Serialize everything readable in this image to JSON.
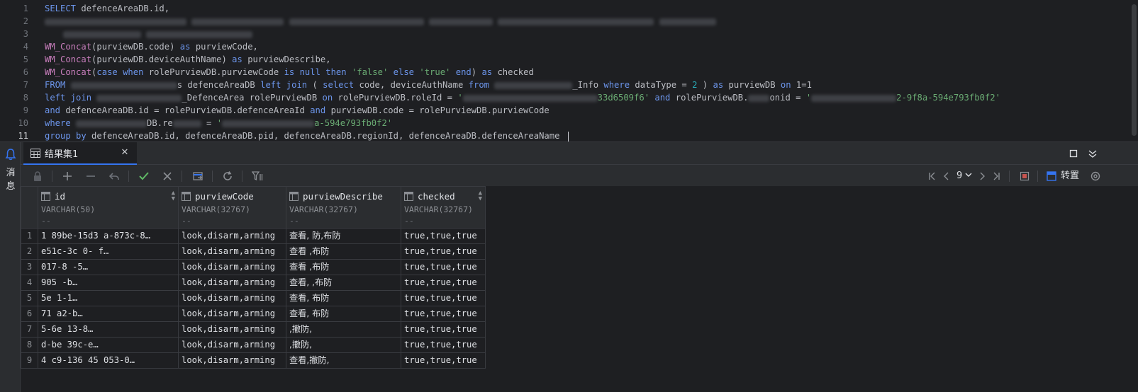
{
  "editor": {
    "line_numbers": [
      "1",
      "2",
      "3",
      "4",
      "5",
      "6",
      "7",
      "8",
      "9",
      "10",
      "11"
    ],
    "lines": {
      "l1": {
        "kw": "SELECT",
        "rest": "defenceAreaDB.id,"
      },
      "l5": {
        "fn": "WM_Concat",
        "a": "(purviewDB.code) ",
        "kw": "as",
        "b": " purviewCode,"
      },
      "l6": {
        "fn": "WM_Concat",
        "a": "(purviewDB.deviceAuthName) ",
        "kw": "as",
        "b": " purviewDescribe,"
      },
      "l7": {
        "fn": "WM_Concat",
        "a": "(",
        "kw1": "case when",
        "b": " rolePurviewDB.purviewCode ",
        "kw2": "is null then",
        "s1": " 'false' ",
        "kw3": "else",
        "s2": " 'true' ",
        "kw4": "end",
        "c": ") ",
        "kw5": "as",
        "d": " checked"
      },
      "l8": {
        "kw1": "FROM",
        "a": "s defenceAreaDB ",
        "kw2": "left join",
        "b": " ( ",
        "kw3": "select",
        "c": " code, deviceAuthName ",
        "kw4": "from",
        "d": "_Info ",
        "kw5": "where",
        "e": " dataType = ",
        "n1": "2",
        "f": " ) ",
        "kw6": "as",
        "g": " purviewDB ",
        "kw7": "on",
        "h": " 1=1"
      },
      "l9": {
        "kw1": "left join",
        "a": "_DefenceArea rolePurviewDB ",
        "kw2": "on",
        "b": " rolePurviewDB.roleId = ",
        "s1": "'",
        "s2": "33d6509f6'",
        "c": " ",
        "kw3": "and",
        "d": " rolePurviewDB.",
        "e": "onid = ",
        "s3": "'",
        "s4": "2-9f8a-594e793fb0f2'"
      },
      "l10": {
        "kw1": "and",
        "a": " defenceAreaDB.id = rolePurviewDB.defenceAreaId ",
        "kw2": "and",
        "b": " purviewDB.code = rolePurviewDB.purviewCode"
      },
      "l11": {
        "kw": "where",
        "a": "DB.re",
        "b": " = ",
        "s1": "'",
        "s2": "a-594e793fb0f2'"
      },
      "l12": {
        "kw": "group by",
        "rest": " defenceAreaDB.id, defenceAreaDB.pid, defenceAreaDB.regionId, defenceAreaDB.defenceAreaName "
      }
    }
  },
  "panel": {
    "side_label": "消息",
    "tab_label": "结果集1",
    "page_number": "9",
    "transpose_label": "转置"
  },
  "grid": {
    "columns": [
      {
        "name": "id",
        "type": "VARCHAR(50)",
        "dash": "--"
      },
      {
        "name": "purviewCode",
        "type": "VARCHAR(32767)",
        "dash": "--"
      },
      {
        "name": "purviewDescribe",
        "type": "VARCHAR(32767)",
        "dash": "--"
      },
      {
        "name": "checked",
        "type": "VARCHAR(32767)",
        "dash": "--"
      }
    ],
    "rows": [
      {
        "n": "1",
        "id": "1    89be-15d3    a-873c-8…",
        "code": "look,disarm,arming",
        "desc": "查看,    防,布防",
        "checked": "true,true,true"
      },
      {
        "n": "2",
        "id": "     e51c-3c    0-    f…",
        "code": "look,disarm,arming",
        "desc": "查看    ,布防",
        "checked": "true,true,true"
      },
      {
        "n": "3",
        "id": "     017-8        -5…",
        "code": "look,disarm,arming",
        "desc": "查看    ,布防",
        "checked": "true,true,true"
      },
      {
        "n": "4",
        "id": "     905           -b…",
        "code": "look,disarm,arming",
        "desc": "查看,    ,布防",
        "checked": "true,true,true"
      },
      {
        "n": "5",
        "id": "        5e        1-1…",
        "code": "look,disarm,arming",
        "desc": "查看,    布防",
        "checked": "true,true,true"
      },
      {
        "n": "6",
        "id": "         71       a2-b…",
        "code": "look,disarm,arming",
        "desc": "查看,    布防",
        "checked": "true,true,true"
      },
      {
        "n": "7",
        "id": "     5-6e        13-8…",
        "code": "look,disarm,arming",
        "desc": "    ,撤防,    ",
        "checked": "true,true,true"
      },
      {
        "n": "8",
        "id": "     d-be        39c-e…",
        "code": "look,disarm,arming",
        "desc": "    ,撤防,    ",
        "checked": "true,true,true"
      },
      {
        "n": "9",
        "id": "4    c9-136    45    053-0…",
        "code": "look,disarm,arming",
        "desc": "查看,撤防,    ",
        "checked": "true,true,true"
      }
    ]
  },
  "colors": {
    "keyword": "#6c95eb",
    "function": "#c77dbb",
    "string": "#6aab73",
    "accent": "#3574f0",
    "ok": "#5fb865"
  }
}
